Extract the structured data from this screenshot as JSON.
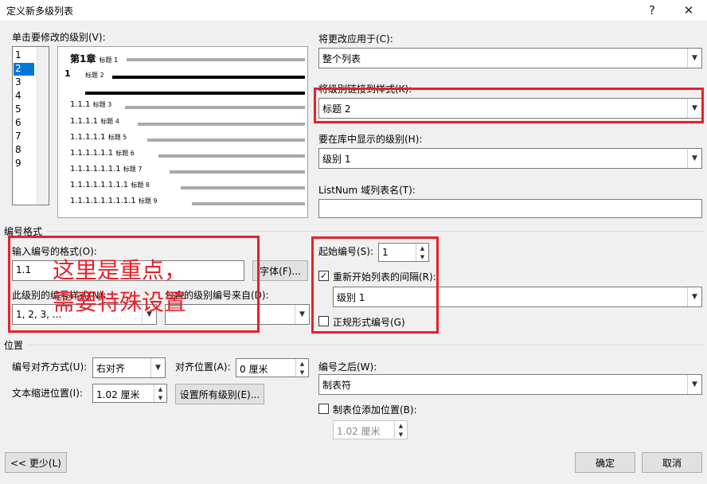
{
  "window": {
    "title": "定义新多级列表",
    "help": "?",
    "close": "✕"
  },
  "level_list": {
    "label": "单击要修改的级别(V):",
    "items": [
      "1",
      "2",
      "3",
      "4",
      "5",
      "6",
      "7",
      "8",
      "9"
    ],
    "selected": "2"
  },
  "preview": {
    "rows": [
      {
        "num": "第1章",
        "style": "标题 1"
      },
      {
        "num": "1",
        "style": "标题 2"
      },
      {
        "num": "1.1.1",
        "style": "标题 3"
      },
      {
        "num": "1.1.1.1",
        "style": "标题 4"
      },
      {
        "num": "1.1.1.1.1",
        "style": "标题 5"
      },
      {
        "num": "1.1.1.1.1.1",
        "style": "标题 6"
      },
      {
        "num": "1.1.1.1.1.1.1",
        "style": "标题 7"
      },
      {
        "num": "1.1.1.1.1.1.1.1",
        "style": "标题 8"
      },
      {
        "num": "1.1.1.1.1.1.1.1.1",
        "style": "标题 9"
      }
    ]
  },
  "right_top": {
    "apply_label": "将更改应用于(C):",
    "apply_value": "整个列表",
    "link_label": "将级别链接到样式(K):",
    "link_value": "标题 2",
    "gallery_label": "要在库中显示的级别(H):",
    "gallery_value": "级别 1",
    "listnum_label": "ListNum 域列表名(T):",
    "listnum_value": ""
  },
  "number_format": {
    "group_label": "编号格式",
    "enter_label": "输入编号的格式(O):",
    "enter_value": "1.1",
    "font_button": "字体(F)...",
    "style_label": "此级别的编号样式(N):",
    "style_value": "1, 2, 3, ...",
    "include_label": "包含的级别编号来自(D):",
    "include_value": "",
    "start_label": "起始编号(S):",
    "start_value": "1",
    "restart_label": "重新开始列表的间隔(R):",
    "restart_checked": "✓",
    "restart_value": "级别 1",
    "legal_label": "正规形式编号(G)",
    "legal_checked": ""
  },
  "annotation": {
    "line1": "这里是重点，",
    "line2": "需要特殊设置"
  },
  "position": {
    "group_label": "位置",
    "align_label": "编号对齐方式(U):",
    "align_value": "右对齐",
    "align_at_label": "对齐位置(A):",
    "align_at_value": "0 厘米",
    "indent_label": "文本缩进位置(I):",
    "indent_value": "1.02 厘米",
    "set_all_button": "设置所有级别(E)...",
    "follow_label": "编号之后(W):",
    "follow_value": "制表符",
    "tab_label": "制表位添加位置(B):",
    "tab_checked": "",
    "tab_value": "1.02 厘米"
  },
  "buttons": {
    "less": "<< 更少(L)",
    "ok": "确定",
    "cancel": "取消"
  }
}
